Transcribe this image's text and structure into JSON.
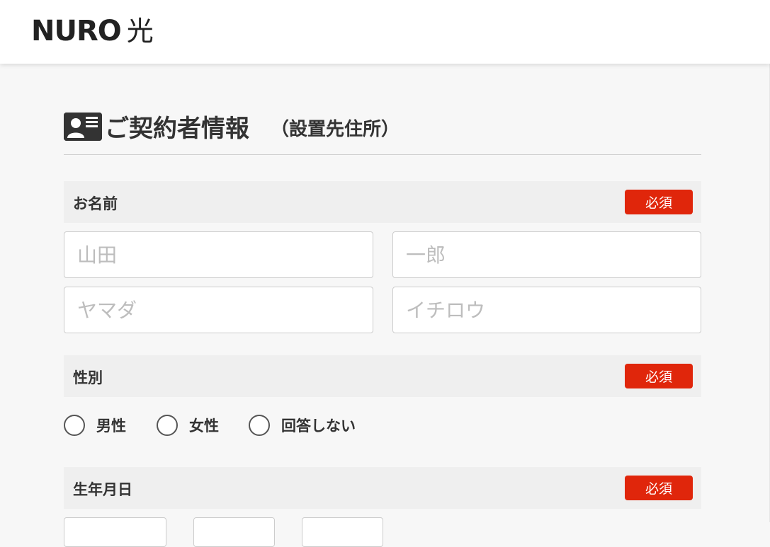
{
  "header": {
    "logo_text": "NURO",
    "logo_kanji": "光"
  },
  "section": {
    "title": "ご契約者情報",
    "subtitle": "（設置先住所）",
    "icon": "id-card-icon"
  },
  "required_label": "必須",
  "name_field": {
    "label": "お名前",
    "last_name_placeholder": "山田",
    "first_name_placeholder": "一郎",
    "last_name_kana_placeholder": "ヤマダ",
    "first_name_kana_placeholder": "イチロウ"
  },
  "gender_field": {
    "label": "性別",
    "options": [
      "男性",
      "女性",
      "回答しない"
    ]
  },
  "birthdate_field": {
    "label": "生年月日"
  },
  "colors": {
    "required_badge": "#e0260b",
    "field_header_bg": "#efefef",
    "page_bg": "#f7f7f7"
  }
}
